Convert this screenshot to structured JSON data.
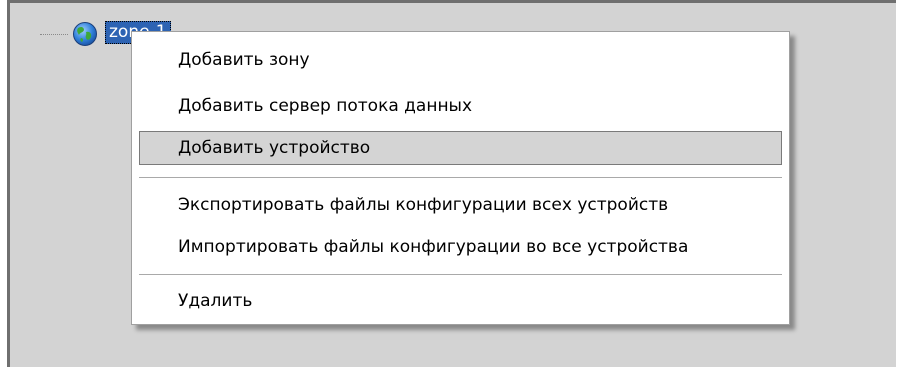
{
  "tree": {
    "node_label": "zone-1",
    "node_icon": "globe-icon"
  },
  "context_menu": {
    "items": [
      {
        "label": "Добавить зону"
      },
      {
        "label": "Добавить сервер потока данных"
      },
      {
        "label": "Добавить устройство",
        "highlighted": true
      },
      {
        "label": "Экспортировать файлы конфигурации всех устройств"
      },
      {
        "label": "Импортировать файлы конфигурации во все устройства"
      },
      {
        "label": "Удалить"
      }
    ]
  },
  "colors": {
    "panel_bg": "#d3d3d3",
    "selection": "#2d63b3",
    "menu_highlight": "#d4d4d4"
  }
}
